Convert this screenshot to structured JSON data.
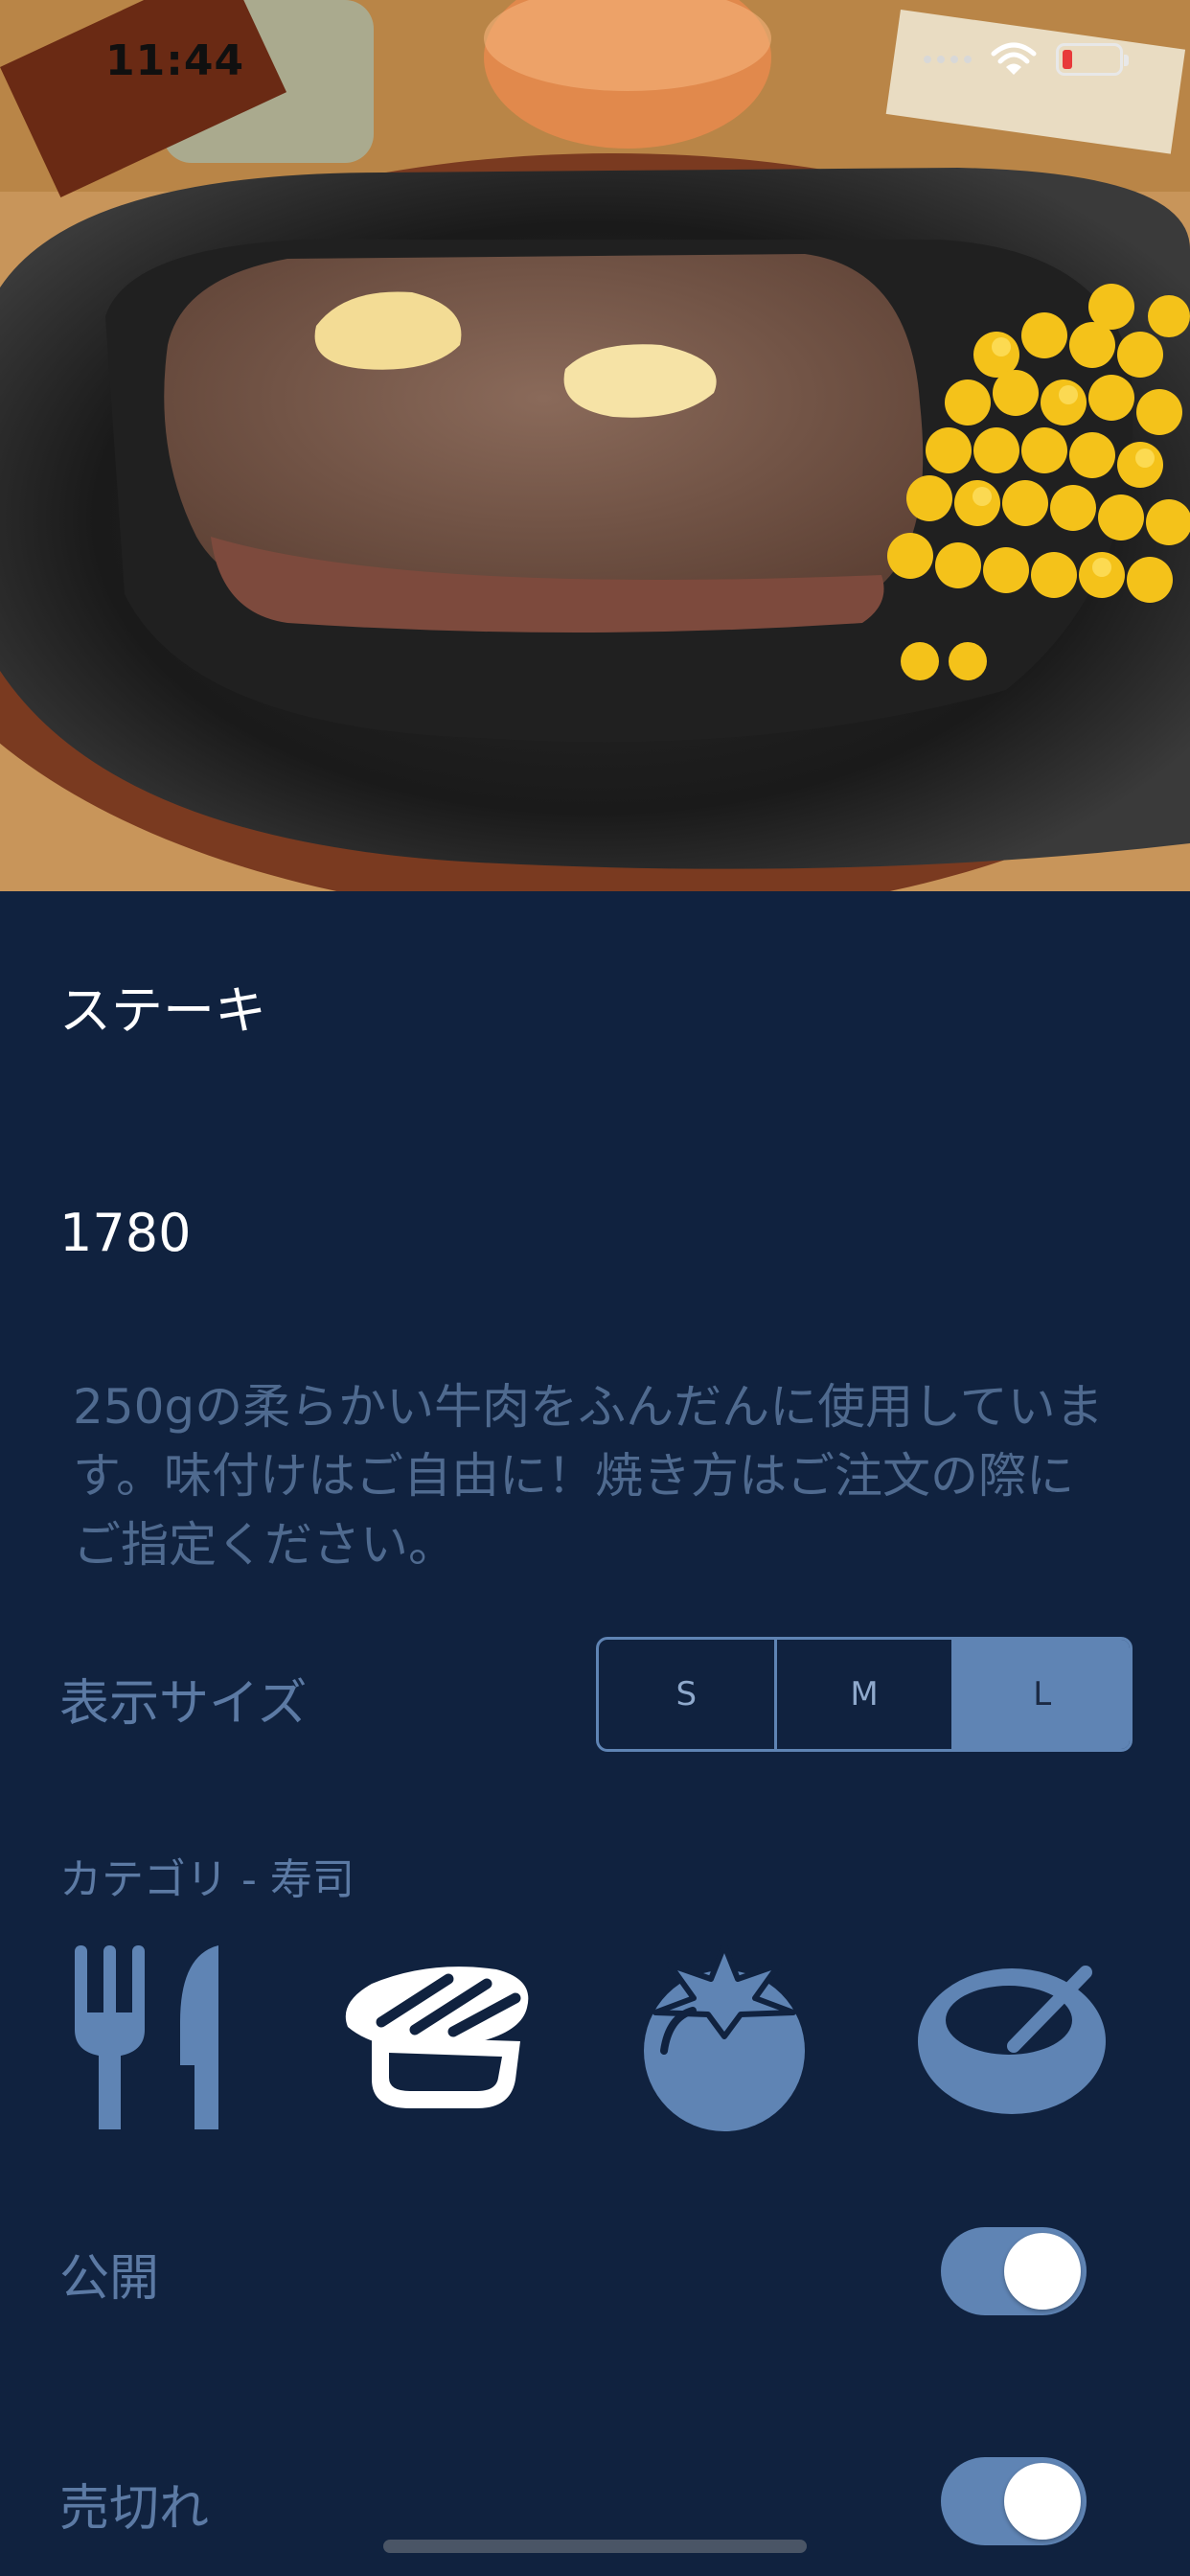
{
  "status_bar": {
    "time": "11:44"
  },
  "item": {
    "name": "ステーキ",
    "price": "1780",
    "description": "250gの柔らかい牛肉をふんだんに使用しています。味付けはご自由に！焼き方はご注文の際にご指定ください。"
  },
  "display_size": {
    "label": "表示サイズ",
    "options": [
      "S",
      "M",
      "L"
    ],
    "selected": "L"
  },
  "category": {
    "label": "カテゴリ - 寿司",
    "icons": [
      "fork-knife-icon",
      "sushi-icon",
      "tomato-icon",
      "bowl-icon"
    ],
    "selected": "sushi-icon"
  },
  "toggles": {
    "public": {
      "label": "公開",
      "on": true
    },
    "sold_out": {
      "label": "売切れ",
      "on": true
    }
  },
  "colors": {
    "background": "#10223f",
    "accent": "#5f84b4",
    "label": "#5c7aa4",
    "selected_icon": "#ffffff"
  }
}
